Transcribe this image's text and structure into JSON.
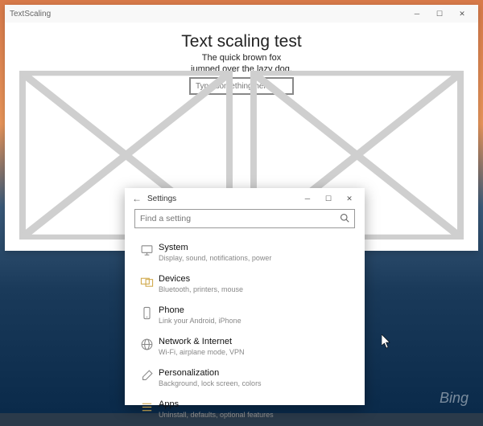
{
  "desktop": {
    "bing_label": "Bing"
  },
  "app": {
    "title": "TextScaling",
    "heading": "Text scaling test",
    "subtext_line1": "The quick brown fox",
    "subtext_line2": "jumped over the lazy dog.",
    "input_placeholder": "Type something here"
  },
  "settings": {
    "title": "Settings",
    "search_placeholder": "Find a setting",
    "items": [
      {
        "title": "System",
        "subtitle": "Display, sound, notifications, power"
      },
      {
        "title": "Devices",
        "subtitle": "Bluetooth, printers, mouse"
      },
      {
        "title": "Phone",
        "subtitle": "Link your Android, iPhone"
      },
      {
        "title": "Network & Internet",
        "subtitle": "Wi-Fi, airplane mode, VPN"
      },
      {
        "title": "Personalization",
        "subtitle": "Background, lock screen, colors"
      },
      {
        "title": "Apps",
        "subtitle": "Uninstall, defaults, optional features"
      }
    ]
  }
}
